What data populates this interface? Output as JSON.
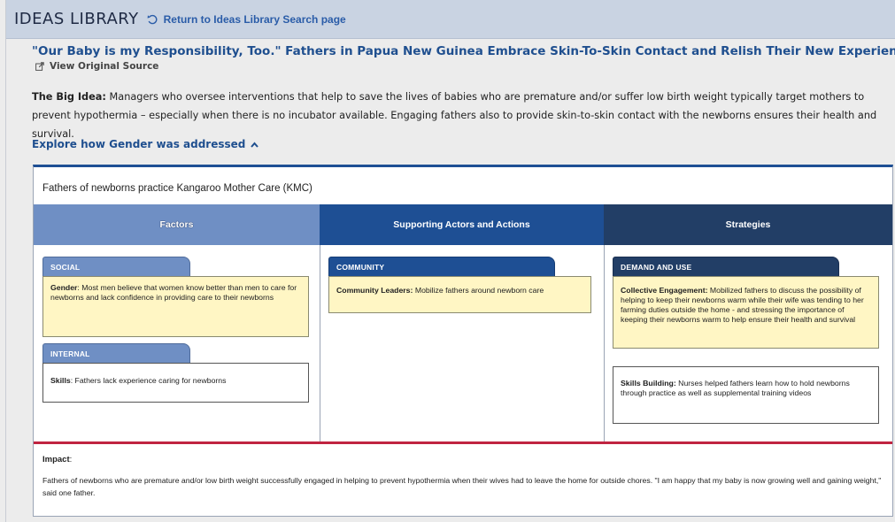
{
  "header": {
    "title": "IDEAS LIBRARY",
    "return_label": "Return to Ideas Library Search page",
    "return_icon": "undo-arrow-icon"
  },
  "story": {
    "title": "\"Our Baby is my Responsibility, Too.\" Fathers in Papua New Guinea Embrace Skin-To-Skin Contact and Relish Their New Experience",
    "source_label": "View Original Source",
    "source_icon": "external-link-icon",
    "big_idea_label": "The Big Idea:",
    "big_idea_text": " Managers who oversee interventions that help to save the lives of babies who are premature and/or suffer low birth weight typically target mothers to prevent hypothermia – especially when there is no incubator available.  Engaging fathers also to provide skin-to-skin contact with the newborns ensures their health and survival.",
    "explore_label": "Explore how Gender was addressed",
    "explore_icon": "chevron-up-icon"
  },
  "panel": {
    "title": "Fathers of newborns practice Kangaroo Mother Care (KMC)",
    "columns": {
      "factors": "Factors",
      "actors": "Supporting Actors and Actions",
      "strategies": "Strategies"
    },
    "factors": {
      "social_tab": "SOCIAL",
      "social_label": "Gender",
      "social_text": ": Most men believe that women know better than men to care for newborns and lack confidence in providing care to their newborns",
      "internal_tab": "INTERNAL",
      "internal_label": "Skills",
      "internal_text": ": Fathers lack experience caring for newborns"
    },
    "actors": {
      "community_tab": "COMMUNITY",
      "community_label": "Community Leaders:",
      "community_text": " Mobilize fathers around newborn care"
    },
    "strategies": {
      "demand_tab": "DEMAND AND USE",
      "collective_label": "Collective Engagement:",
      "collective_text": " Mobilized fathers to discuss the possibility of helping to keep their newborns warm while their wife was tending to her farming duties outside the home - and stressing the importance of keeping their newborns warm to help ensure their health and survival",
      "skills_label": "Skills Building:",
      "skills_text": " Nurses helped fathers learn how to hold newborns through practice as well as supplemental training videos"
    },
    "impact_label": "Impact",
    "impact_colon": ":",
    "impact_text": "Fathers of newborns who are premature and/or low birth weight successfully engaged in helping to prevent hypothermia when their wives had to leave the home for outside chores.  \"I am happy that my baby is now growing well and gaining weight,\" said one father."
  },
  "colors": {
    "header_bg": "#c9d3e2",
    "link": "#1f4f8f",
    "factors": "#6f8fc4",
    "actors": "#1e4f94",
    "strategies": "#223e66",
    "card_yellow": "#fff6c4",
    "impact_rule": "#c02440"
  }
}
